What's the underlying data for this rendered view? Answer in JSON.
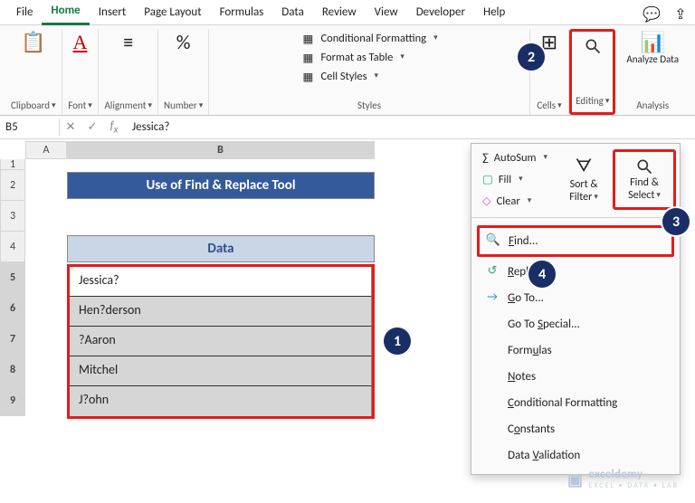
{
  "tabs": [
    "File",
    "Home",
    "Insert",
    "Page Layout",
    "Formulas",
    "Data",
    "Review",
    "View",
    "Developer",
    "Help"
  ],
  "active_tab": 1,
  "ribbon": {
    "clipboard": "Clipboard",
    "font": "Font",
    "alignment": "Alignment",
    "number": "Number",
    "cells": "Cells",
    "editing": "Editing",
    "analyze": "Analyze Data",
    "styles_label": "Styles",
    "analysis_label": "Analysis",
    "cond_format": "Conditional Formatting",
    "format_table": "Format as Table",
    "cell_styles": "Cell Styles",
    "percent_glyph": "%"
  },
  "namebox": "B5",
  "formula_bar": "Jessica?",
  "sheet": {
    "title": "Use of Find & Replace Tool",
    "header": "Data",
    "rows": [
      "Jessica?",
      "Hen?derson",
      "?Aaron",
      "Mitchel",
      "J?ohn"
    ],
    "col_widths": {
      "A": 46,
      "B": 340
    },
    "row_labels": [
      "1",
      "2",
      "3",
      "4",
      "5",
      "6",
      "7",
      "8",
      "9"
    ]
  },
  "dropdown": {
    "autosum": "AutoSum",
    "fill": "Fill",
    "clear": "Clear",
    "sortfilter": "Sort & Filter",
    "findselect": "Find & Select",
    "items": [
      "Find...",
      "Replace...",
      "Go To...",
      "Go To Special...",
      "Formulas",
      "Notes",
      "Conditional Formatting",
      "Constants",
      "Data Validation"
    ]
  },
  "callouts": {
    "c1": "1",
    "c2": "2",
    "c3": "3",
    "c4": "4"
  },
  "watermark": {
    "brand": "exceldemy",
    "sub": "EXCEL • DATA • LAB"
  },
  "icons": {
    "clipboard": "📋",
    "font": "A",
    "align": "≡",
    "number_ico": "%",
    "grid": "▦",
    "cells": "⊞",
    "chart": "📊",
    "sigma": "Σ",
    "fill": "▢",
    "clear": "◇",
    "sort": "⇅",
    "find": "🔍",
    "replace": "↺",
    "goto": "→"
  }
}
